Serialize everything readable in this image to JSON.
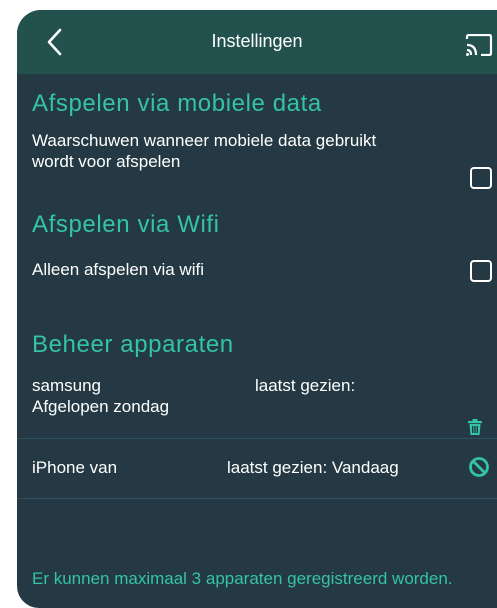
{
  "header": {
    "title": "Instellingen",
    "back_icon": "chevron-left-icon",
    "cast_icon": "cast-icon"
  },
  "mobile_data": {
    "section_title": "Afspelen via mobiele data",
    "warn_label_line1": "Waarschuwen wanneer mobiele data gebruikt",
    "warn_label_line2": "wordt voor afspelen",
    "warn_checked": false
  },
  "wifi": {
    "section_title": "Afspelen via Wifi",
    "only_wifi_label": "Alleen afspelen via wifi",
    "only_wifi_checked": false
  },
  "devices": {
    "section_title": "Beheer apparaten",
    "items": [
      {
        "name": "samsung",
        "last_seen": "laatst gezien:",
        "last_seen_value": "Afgelopen zondag",
        "action_icon": "trash-icon"
      },
      {
        "name": "iPhone van",
        "last_seen": "laatst gezien: Vandaag",
        "action_icon": "block-icon"
      }
    ],
    "footer_note": "Er kunnen maximaal 3 apparaten geregistreerd worden."
  },
  "colors": {
    "background": "#243943",
    "header": "#23524e",
    "accent": "#34c3a7",
    "text": "#ffffff"
  }
}
